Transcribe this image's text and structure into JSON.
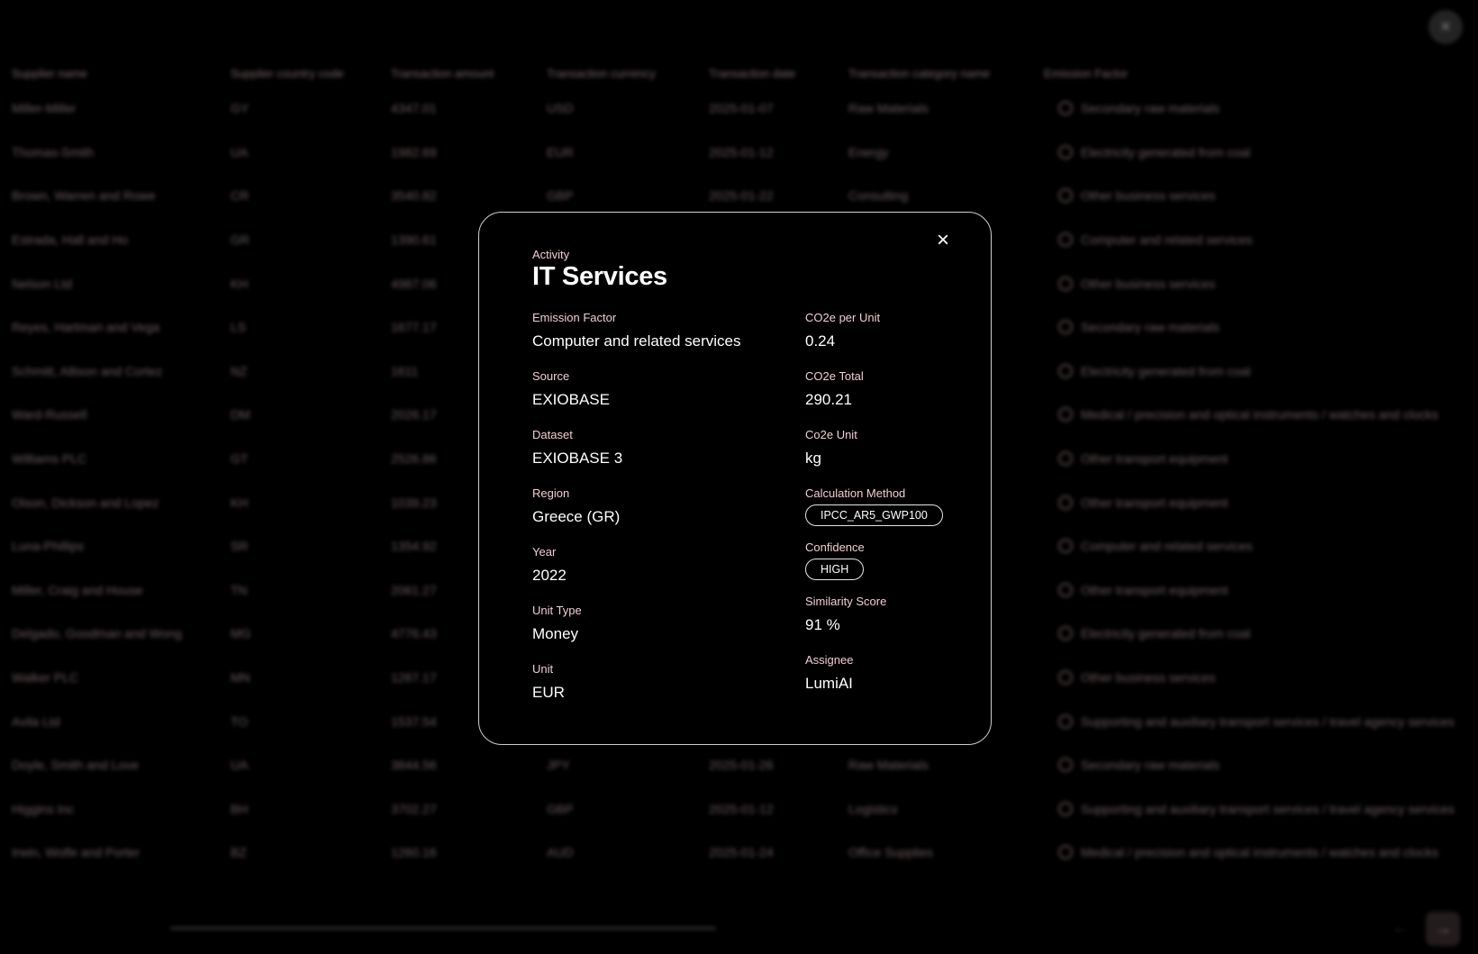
{
  "background": {
    "columns": [
      "Supplier name",
      "Supplier country code",
      "Transaction amount",
      "Transaction currency",
      "Transaction date",
      "Transaction category name",
      "Emission Factor"
    ],
    "rows": [
      [
        "Miller-Miller",
        "GY",
        "4347.01",
        "USD",
        "2025-01-07",
        "Raw Materials",
        "Secondary raw materials"
      ],
      [
        "Thomas-Smith",
        "UA",
        "1982.69",
        "EUR",
        "2025-01-12",
        "Energy",
        "Electricity generated from coal"
      ],
      [
        "Brown, Warren and Rowe",
        "CR",
        "3540.82",
        "GBP",
        "2025-01-22",
        "Consulting",
        "Other business services"
      ],
      [
        "Estrada, Hall and Ho",
        "GR",
        "1390.61",
        "",
        "",
        "",
        "Computer and related services"
      ],
      [
        "Nelson Ltd",
        "KH",
        "4987.06",
        "",
        "",
        "",
        "Other business services"
      ],
      [
        "Reyes, Hartman and Vega",
        "LS",
        "1677.17",
        "",
        "",
        "",
        "Secondary raw materials"
      ],
      [
        "Schmitt, Allison and Cortez",
        "NZ",
        "1611",
        "",
        "",
        "",
        "Electricity generated from coal"
      ],
      [
        "Ward-Russell",
        "DM",
        "2026.17",
        "",
        "",
        "",
        "Medical / precision and optical instruments / watches and clocks"
      ],
      [
        "Williams PLC",
        "GT",
        "2526.86",
        "",
        "",
        "",
        "Other transport equipment"
      ],
      [
        "Olson, Dickson and Lopez",
        "KH",
        "1039.23",
        "",
        "",
        "",
        "Other transport equipment"
      ],
      [
        "Luna-Phillips",
        "SR",
        "1354.92",
        "",
        "",
        "",
        "Computer and related services"
      ],
      [
        "Miller, Craig and House",
        "TN",
        "2061.27",
        "",
        "",
        "",
        "Other transport equipment"
      ],
      [
        "Delgado, Goodman and Wong",
        "MG",
        "4776.43",
        "",
        "",
        "",
        "Electricity generated from coal"
      ],
      [
        "Walker PLC",
        "MN",
        "1267.17",
        "",
        "",
        "",
        "Other business services"
      ],
      [
        "Avila Ltd",
        "TO",
        "1537.54",
        "",
        "",
        "",
        "Supporting and auxiliary transport services / travel agency services"
      ],
      [
        "Doyle, Smith and Love",
        "UA",
        "3844.56",
        "JPY",
        "2025-01-26",
        "Raw Materials",
        "Secondary raw materials"
      ],
      [
        "Higgins Inc",
        "BH",
        "3702.27",
        "GBP",
        "2025-01-12",
        "Logistics",
        "Supporting and auxiliary transport services / travel agency services"
      ],
      [
        "Irwin, Wolfe and Porter",
        "BZ",
        "1260.16",
        "AUD",
        "2025-01-24",
        "Office Supplies",
        "Medical / precision and optical instruments / watches and clocks"
      ]
    ],
    "close_icon": "×",
    "next_icon": "→",
    "prev_icon": "←"
  },
  "modal": {
    "close_icon": "×",
    "activity_label": "Activity",
    "activity_title": "IT Services",
    "left_fields": [
      {
        "label": "Emission Factor",
        "value": "Computer and related services"
      },
      {
        "label": "Source",
        "value": "EXIOBASE"
      },
      {
        "label": "Dataset",
        "value": "EXIOBASE 3"
      },
      {
        "label": "Region",
        "value": "Greece (GR)"
      },
      {
        "label": "Year",
        "value": "2022"
      },
      {
        "label": "Unit Type",
        "value": "Money"
      },
      {
        "label": "Unit",
        "value": "EUR"
      }
    ],
    "right_fields": {
      "co2e_per_unit": {
        "label": "CO2e per Unit",
        "value": "0.24"
      },
      "co2e_total": {
        "label": "CO2e Total",
        "value": "290.21"
      },
      "co2e_unit": {
        "label": "Co2e Unit",
        "value": "kg"
      },
      "calculation_method": {
        "label": "Calculation Method",
        "value": "IPCC_AR5_GWP100"
      },
      "confidence": {
        "label": "Confidence",
        "value": "HIGH"
      },
      "similarity_score": {
        "label": "Similarity Score",
        "value": "91 %"
      },
      "assignee": {
        "label": "Assignee",
        "value": "LumiAI"
      }
    }
  },
  "colors": {
    "label_pink": "#f3cdd3",
    "background": "#000000",
    "modal_border": "#cfcfcf"
  }
}
